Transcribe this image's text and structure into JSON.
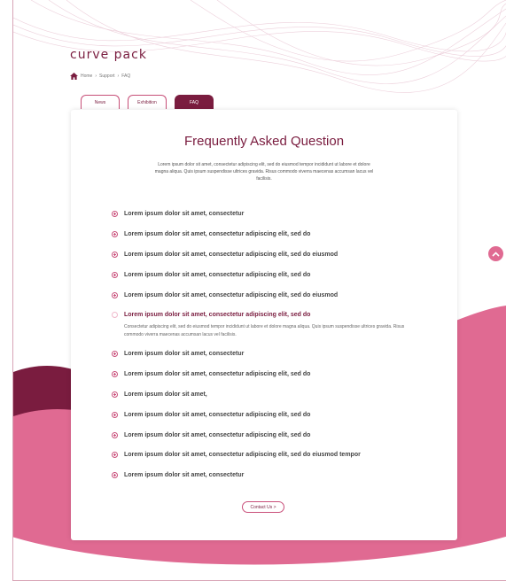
{
  "brand": {
    "logo": "curve pack",
    "accent": "#7a1c3f",
    "pink": "#e06a92"
  },
  "breadcrumb": {
    "items": [
      "Home",
      "Support",
      "FAQ"
    ],
    "separator": "›"
  },
  "tabs": [
    {
      "label": "News",
      "active": false
    },
    {
      "label": "Exhibition",
      "active": false
    },
    {
      "label": "FAQ",
      "active": true
    }
  ],
  "faq": {
    "title": "Frequently Asked Question",
    "intro": "Lorem ipsum dolor sit amet, consectetur adipiscing elit, sed do eiusmod tempor incididunt ut labore et dolore magna aliqua. Quis ipsum suspendisse ultrices gravida. Risus commodo viverra maecenas accumsan lacus vel facilisis.",
    "items": [
      {
        "q": "Lorem ipsum dolor sit amet, consectetur",
        "expanded": false
      },
      {
        "q": "Lorem ipsum dolor sit amet, consectetur adipiscing elit, sed do",
        "expanded": false
      },
      {
        "q": "Lorem ipsum dolor sit amet, consectetur adipiscing elit, sed do eiusmod",
        "expanded": false
      },
      {
        "q": "Lorem ipsum dolor sit amet, consectetur adipiscing elit, sed do",
        "expanded": false
      },
      {
        "q": "Lorem ipsum dolor sit amet, consectetur adipiscing elit, sed do eiusmod",
        "expanded": false
      },
      {
        "q": "Lorem ipsum dolor sit amet, consectetur adipiscing elit, sed do",
        "expanded": true
      },
      {
        "q": "Lorem ipsum dolor sit amet, consectetur",
        "expanded": false
      },
      {
        "q": "Lorem ipsum dolor sit amet, consectetur adipiscing elit, sed do",
        "expanded": false
      },
      {
        "q": "Lorem ipsum dolor sit amet,",
        "expanded": false
      },
      {
        "q": "Lorem ipsum dolor sit amet, consectetur adipiscing elit, sed do",
        "expanded": false
      },
      {
        "q": "Lorem ipsum dolor sit amet, consectetur adipiscing elit, sed do",
        "expanded": false
      },
      {
        "q": "Lorem ipsum dolor sit amet, consectetur adipiscing elit, sed do eiusmod tempor",
        "expanded": false
      },
      {
        "q": "Lorem ipsum dolor sit amet, consectetur",
        "expanded": false
      }
    ],
    "answer": "Consectetur adipiscing elit, sed do eiusmod tempor incididunt ut labore et dolore magna aliqua. Quis ipsum suspendisse ultrices gravida. Risus commodo viverra maecenas accumsan lacus vel facilisis.",
    "contact_label": "Contact Us  >"
  }
}
